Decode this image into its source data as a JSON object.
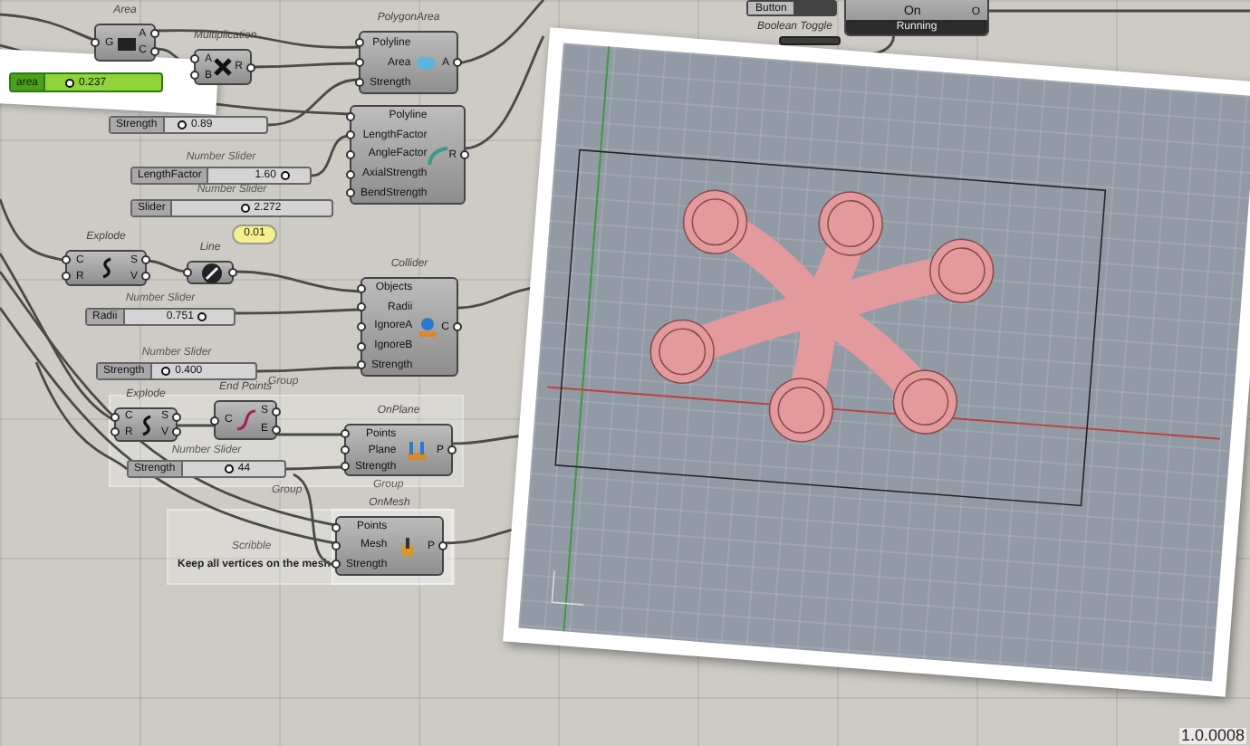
{
  "canvas": {
    "nodes": [
      {
        "kind": "component",
        "title": "Area",
        "inputs": [
          "G"
        ],
        "outputs": [
          "A",
          "C"
        ]
      },
      {
        "kind": "component",
        "title": "Multiplication",
        "inputs": [
          "A",
          "B"
        ],
        "outputs": [
          "R"
        ]
      },
      {
        "kind": "slider",
        "label": "area",
        "value": "0.237",
        "level": 0.17,
        "highlighted": true
      },
      {
        "kind": "component",
        "title": "PolygonArea",
        "inputs": [
          "Polyline",
          "Area",
          "Strength"
        ],
        "outputs": [
          "A"
        ]
      },
      {
        "kind": "slider",
        "label": "Strength",
        "value": "0.89",
        "level": 0.12,
        "highlighted": false
      },
      {
        "kind": "component",
        "inputs": [
          "Polyline",
          "LengthFactor",
          "AngleFactor",
          "AxialStrength",
          "BendStrength"
        ],
        "outputs": [
          "R"
        ]
      },
      {
        "kind": "slider",
        "title": "Number Slider",
        "label": "LengthFactor",
        "value": "1.60",
        "level": 0.8,
        "highlighted": false
      },
      {
        "kind": "slider",
        "title": "Number Slider",
        "label": "Slider",
        "value": "2.272",
        "level": 0.45,
        "highlighted": false
      },
      {
        "kind": "panel",
        "value": "0.01"
      },
      {
        "kind": "component",
        "title": "Explode",
        "inputs": [
          "C",
          "R"
        ],
        "outputs": [
          "S",
          "V"
        ]
      },
      {
        "kind": "component",
        "title": "Line"
      },
      {
        "kind": "component",
        "title": "Collider",
        "inputs": [
          "Objects",
          "Radii",
          "IgnoreA",
          "IgnoreB",
          "Strength"
        ],
        "outputs": [
          "C"
        ]
      },
      {
        "kind": "slider",
        "title": "Number Slider",
        "label": "Radii",
        "value": "0.751",
        "level": 0.75,
        "highlighted": false
      },
      {
        "kind": "slider",
        "title": "Number Slider",
        "label": "Strength",
        "value": "0.400",
        "level": 0.08,
        "highlighted": false
      },
      {
        "kind": "component",
        "title": "Explode",
        "inputs": [
          "C",
          "R"
        ],
        "outputs": [
          "S",
          "V"
        ]
      },
      {
        "kind": "component",
        "title": "End Points",
        "inputs": [
          "C"
        ],
        "outputs": [
          "S",
          "E"
        ]
      },
      {
        "kind": "slider",
        "title": "Number Slider",
        "label": "Strength",
        "value": "44",
        "level": 0.45,
        "highlighted": false
      },
      {
        "kind": "component",
        "title": "OnPlane",
        "inputs": [
          "Points",
          "Plane",
          "Strength"
        ],
        "outputs": [
          "P"
        ]
      },
      {
        "kind": "component",
        "title": "OnMesh",
        "inputs": [
          "Points",
          "Mesh",
          "Strength"
        ],
        "outputs": [
          "P"
        ]
      },
      {
        "kind": "button",
        "label": "Button"
      },
      {
        "kind": "toggle",
        "title": "Boolean Toggle"
      },
      {
        "kind": "status",
        "value": "On",
        "status": "Running",
        "outputs": [
          "O"
        ]
      }
    ],
    "groups": [
      {
        "label": "Group"
      },
      {
        "label": "Group"
      },
      {
        "label": "Group"
      }
    ],
    "scribble": {
      "title": "Scribble",
      "text": "Keep all vertices on the mesh"
    },
    "version": "1.0.0008"
  }
}
